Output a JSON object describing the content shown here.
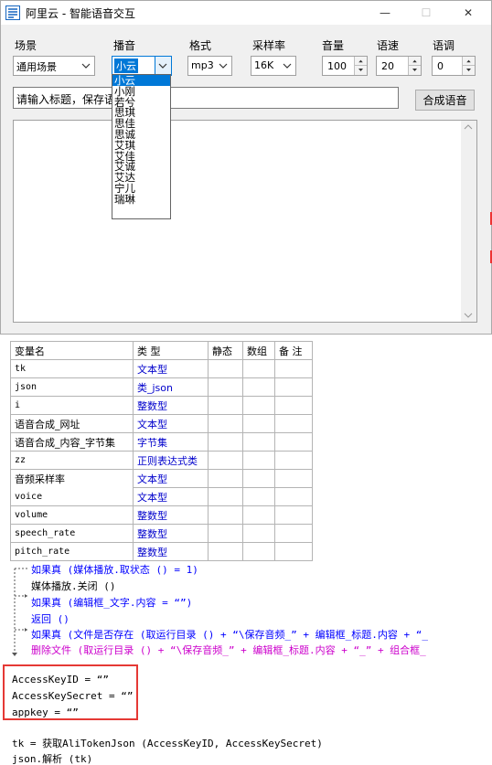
{
  "window": {
    "title": "阿里云 - 智能语音交互",
    "controls": {
      "minimize": "—",
      "maximize": "☐",
      "close": "✕"
    }
  },
  "settings": {
    "scene": {
      "label": "场景",
      "value": "通用场景"
    },
    "speaker": {
      "label": "播音",
      "value": "小云"
    },
    "format": {
      "label": "格式",
      "value": "mp3"
    },
    "sample_rate": {
      "label": "采样率",
      "value": "16K"
    },
    "volume": {
      "label": "音量",
      "value": "100"
    },
    "speed": {
      "label": "语速",
      "value": "20"
    },
    "pitch": {
      "label": "语调",
      "value": "0"
    }
  },
  "title_input": {
    "value": "请输入标题，保存语"
  },
  "synth_button": "合成语音",
  "speaker_options": [
    "小云",
    "小刚",
    "若兮",
    "思琪",
    "思佳",
    "思诚",
    "艾琪",
    "艾佳",
    "艾诚",
    "艾达",
    "宁儿",
    "瑞琳"
  ],
  "var_table": {
    "headers": [
      "变量名",
      "类 型",
      "静态",
      "数组",
      "备 注"
    ],
    "rows": [
      {
        "name": "tk",
        "type": "文本型",
        "name_mono": true
      },
      {
        "name": "json",
        "type": "类_json",
        "name_mono": true
      },
      {
        "name": "i",
        "type": "整数型",
        "name_mono": true
      },
      {
        "name": "语音合成_网址",
        "type": "文本型",
        "name_mono": false
      },
      {
        "name": "语音合成_内容_字节集",
        "type": "字节集",
        "name_mono": false
      },
      {
        "name": "zz",
        "type": "正则表达式类",
        "name_mono": true
      },
      {
        "name": "音频采样率",
        "type": "文本型",
        "name_mono": false
      },
      {
        "name": "voice",
        "type": "文本型",
        "name_mono": true
      },
      {
        "name": "volume",
        "type": "整数型",
        "name_mono": true
      },
      {
        "name": "speech_rate",
        "type": "整数型",
        "name_mono": true
      },
      {
        "name": "pitch_rate",
        "type": "整数型",
        "name_mono": true
      }
    ]
  },
  "code": {
    "line1": "如果真 (媒体播放.取状态 () = 1)",
    "line2": "媒体播放.关闭 ()",
    "line3": "如果真 (编辑框_文字.内容 = “”)",
    "line4": "返回 ()",
    "line5": "如果真 (文件是否存在 (取运行目录 () + “\\保存音频_” + 编辑框_标题.内容 + “_",
    "line6": "删除文件 (取运行目录 () + “\\保存音频_” + 编辑框_标题.内容 + “_” + 组合框_",
    "key_id": "AccessKeyID = “”",
    "key_secret": "AccessKeySecret = “”",
    "appkey": "appkey = “”",
    "tk_line": "tk = 获取AliTokenJson (AccessKeyID, AccessKeySecret)",
    "json_line": "json.解析 (tk)"
  }
}
